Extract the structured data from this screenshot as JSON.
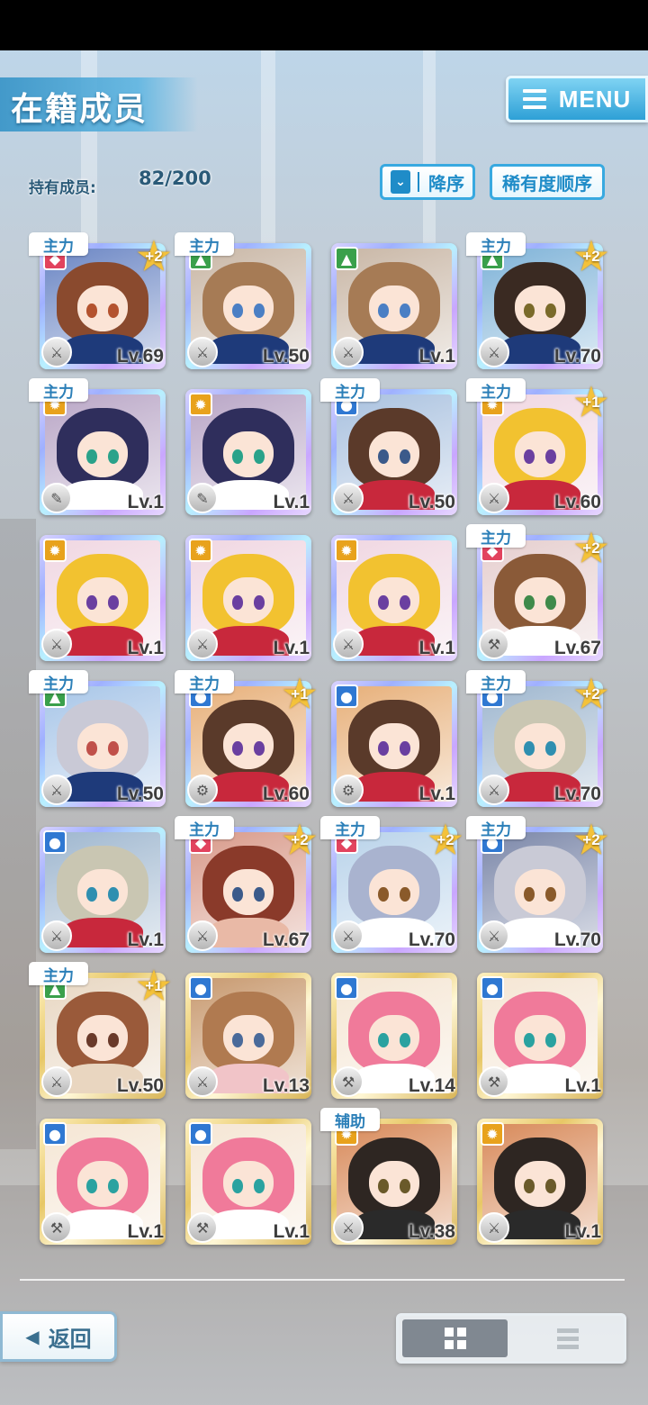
{
  "header": {
    "title": "在籍成员",
    "menu_label": "MENU"
  },
  "summary": {
    "holding_label": "持有成员:",
    "holding_count": "82/200"
  },
  "sort": {
    "order_label": "降序",
    "rarity_label": "稀有度顺序"
  },
  "colors": {
    "accent": "#2ea0d6",
    "role_tag_text": "#2b7fb8",
    "badge_gold": "#f4c23a"
  },
  "cards": [
    {
      "level": "Lv.69",
      "plus": "+2",
      "role": "主力",
      "attr": "red-icon",
      "attr_color": "#e2435e",
      "hair": "#8a4a2e",
      "eyes": "#b4532f",
      "cloth": "#1e3a7a",
      "bg": "#6b86c4",
      "frame": "rainbow",
      "type": "sword-icon"
    },
    {
      "level": "Lv.50",
      "plus": "",
      "role": "主力",
      "attr": "green-icon",
      "attr_color": "#3aa04b",
      "hair": "#a67b55",
      "eyes": "#4b7fc4",
      "cloth": "#1e3a7a",
      "bg": "#c9b7a6",
      "frame": "rainbow",
      "type": "sword-icon"
    },
    {
      "level": "Lv.1",
      "plus": "",
      "role": "",
      "attr": "green-icon",
      "attr_color": "#3aa04b",
      "hair": "#a67b55",
      "eyes": "#4b7fc4",
      "cloth": "#1e3a7a",
      "bg": "#c9b7a6",
      "frame": "rainbow",
      "type": "sword-icon"
    },
    {
      "level": "Lv.70",
      "plus": "+2",
      "role": "主力",
      "attr": "green-icon",
      "attr_color": "#3aa04b",
      "hair": "#3a2a22",
      "eyes": "#7a6a2a",
      "cloth": "#1e3a7a",
      "bg": "#7fb3d8",
      "frame": "rainbow",
      "type": "sword-icon"
    },
    {
      "level": "Lv.1",
      "plus": "",
      "role": "主力",
      "attr": "yellow-icon",
      "attr_color": "#e8a21c",
      "hair": "#2f2e5c",
      "eyes": "#2aa28a",
      "cloth": "#ffffff",
      "bg": "#b9a6c6",
      "frame": "rainbow",
      "type": "wrench-icon"
    },
    {
      "level": "Lv.1",
      "plus": "",
      "role": "",
      "attr": "yellow-icon",
      "attr_color": "#e8a21c",
      "hair": "#2f2e5c",
      "eyes": "#2aa28a",
      "cloth": "#ffffff",
      "bg": "#b9a6c6",
      "frame": "rainbow",
      "type": "wrench-icon"
    },
    {
      "level": "Lv.50",
      "plus": "",
      "role": "主力",
      "attr": "blue-icon",
      "attr_color": "#2f78d2",
      "hair": "#5b3a2a",
      "eyes": "#3b5a8a",
      "cloth": "#c8283c",
      "bg": "#a9c1df",
      "frame": "rainbow",
      "type": "sword-icon"
    },
    {
      "level": "Lv.60",
      "plus": "+1",
      "role": "主力",
      "attr": "yellow-icon",
      "attr_color": "#e8a21c",
      "hair": "#f2c230",
      "eyes": "#6a3fa0",
      "cloth": "#c8283c",
      "bg": "#f0d7e2",
      "frame": "rainbow",
      "type": "sword-icon"
    },
    {
      "level": "Lv.1",
      "plus": "",
      "role": "",
      "attr": "yellow-icon",
      "attr_color": "#e8a21c",
      "hair": "#f2c230",
      "eyes": "#6a3fa0",
      "cloth": "#c8283c",
      "bg": "#f0d7e2",
      "frame": "rainbow",
      "type": "sword-icon"
    },
    {
      "level": "Lv.1",
      "plus": "",
      "role": "",
      "attr": "yellow-icon",
      "attr_color": "#e8a21c",
      "hair": "#f2c230",
      "eyes": "#6a3fa0",
      "cloth": "#c8283c",
      "bg": "#f0d7e2",
      "frame": "rainbow",
      "type": "sword-icon"
    },
    {
      "level": "Lv.1",
      "plus": "",
      "role": "",
      "attr": "yellow-icon",
      "attr_color": "#e8a21c",
      "hair": "#f2c230",
      "eyes": "#6a3fa0",
      "cloth": "#c8283c",
      "bg": "#f0d7e2",
      "frame": "rainbow",
      "type": "sword-icon"
    },
    {
      "level": "Lv.67",
      "plus": "+2",
      "role": "主力",
      "attr": "red-icon",
      "attr_color": "#e2435e",
      "hair": "#8a5a38",
      "eyes": "#3f8a4a",
      "cloth": "#ffffff",
      "bg": "#e6cfcf",
      "frame": "rainbow",
      "type": "hammer-icon"
    },
    {
      "level": "Lv.50",
      "plus": "",
      "role": "主力",
      "attr": "green-icon",
      "attr_color": "#3aa04b",
      "hair": "#c9c9d6",
      "eyes": "#c0504a",
      "cloth": "#1e3a7a",
      "bg": "#a8c6e8",
      "frame": "rainbow",
      "type": "sword-icon"
    },
    {
      "level": "Lv.60",
      "plus": "+1",
      "role": "主力",
      "attr": "blue-icon",
      "attr_color": "#2f78d2",
      "hair": "#5a3a2a",
      "eyes": "#6a3fa0",
      "cloth": "#c8283c",
      "bg": "#e7b07a",
      "frame": "rainbow",
      "type": "gear-icon"
    },
    {
      "level": "Lv.1",
      "plus": "",
      "role": "",
      "attr": "blue-icon",
      "attr_color": "#2f78d2",
      "hair": "#5a3a2a",
      "eyes": "#6a3fa0",
      "cloth": "#c8283c",
      "bg": "#e7b07a",
      "frame": "rainbow",
      "type": "gear-icon"
    },
    {
      "level": "Lv.70",
      "plus": "+2",
      "role": "主力",
      "attr": "blue-icon",
      "attr_color": "#2f78d2",
      "hair": "#c9c6b2",
      "eyes": "#2f8fb0",
      "cloth": "#c8283c",
      "bg": "#9fb7cf",
      "frame": "rainbow",
      "type": "sword-icon"
    },
    {
      "level": "Lv.1",
      "plus": "",
      "role": "",
      "attr": "blue-icon",
      "attr_color": "#2f78d2",
      "hair": "#c9c6b2",
      "eyes": "#2f8fb0",
      "cloth": "#c8283c",
      "bg": "#9fb7cf",
      "frame": "rainbow",
      "type": "sword-icon"
    },
    {
      "level": "Lv.67",
      "plus": "+2",
      "role": "主力",
      "attr": "red-icon",
      "attr_color": "#e2435e",
      "hair": "#8a3a2a",
      "eyes": "#3b5a8a",
      "cloth": "#e9b9a6",
      "bg": "#d89a8a",
      "frame": "rainbow",
      "type": "sword-icon"
    },
    {
      "level": "Lv.70",
      "plus": "+2",
      "role": "主力",
      "attr": "red-icon",
      "attr_color": "#e2435e",
      "hair": "#a9b3cf",
      "eyes": "#8a5a2a",
      "cloth": "#ffffff",
      "bg": "#b9d3ea",
      "frame": "rainbow",
      "type": "sword-icon"
    },
    {
      "level": "Lv.70",
      "plus": "+2",
      "role": "主力",
      "attr": "blue-icon",
      "attr_color": "#2f78d2",
      "hair": "#c9cad6",
      "eyes": "#8a5a2a",
      "cloth": "#ffffff",
      "bg": "#7a86a8",
      "frame": "rainbow",
      "type": "sword-icon"
    },
    {
      "level": "Lv.50",
      "plus": "+1",
      "role": "主力",
      "attr": "green-icon",
      "attr_color": "#3aa04b",
      "hair": "#9a5a3a",
      "eyes": "#6a3a2a",
      "cloth": "#e9d6c0",
      "bg": "#e8d7c2",
      "frame": "gold",
      "type": "sword-icon"
    },
    {
      "level": "Lv.13",
      "plus": "",
      "role": "",
      "attr": "blue-icon",
      "attr_color": "#2f78d2",
      "hair": "#b07a50",
      "eyes": "#4a6a9a",
      "cloth": "#f1c4c8",
      "bg": "#c89a70",
      "frame": "gold",
      "type": "sword-icon"
    },
    {
      "level": "Lv.14",
      "plus": "",
      "role": "",
      "attr": "blue-icon",
      "attr_color": "#2f78d2",
      "hair": "#f07a9a",
      "eyes": "#2aa2a0",
      "cloth": "#ffffff",
      "bg": "#f5e6d4",
      "frame": "gold",
      "type": "hammer-icon"
    },
    {
      "level": "Lv.1",
      "plus": "",
      "role": "",
      "attr": "blue-icon",
      "attr_color": "#2f78d2",
      "hair": "#f07a9a",
      "eyes": "#2aa2a0",
      "cloth": "#ffffff",
      "bg": "#f5e6d4",
      "frame": "gold",
      "type": "hammer-icon"
    },
    {
      "level": "Lv.1",
      "plus": "",
      "role": "",
      "attr": "blue-icon",
      "attr_color": "#2f78d2",
      "hair": "#f07a9a",
      "eyes": "#2aa2a0",
      "cloth": "#ffffff",
      "bg": "#f5e6d4",
      "frame": "gold",
      "type": "hammer-icon"
    },
    {
      "level": "Lv.1",
      "plus": "",
      "role": "",
      "attr": "blue-icon",
      "attr_color": "#2f78d2",
      "hair": "#f07a9a",
      "eyes": "#2aa2a0",
      "cloth": "#ffffff",
      "bg": "#f5e6d4",
      "frame": "gold",
      "type": "hammer-icon"
    },
    {
      "level": "Lv.38",
      "plus": "",
      "role": "辅助",
      "attr": "yellow-icon",
      "attr_color": "#e8a21c",
      "hair": "#2e2622",
      "eyes": "#6a5a2a",
      "cloth": "#2a2a2a",
      "bg": "#d88a5a",
      "frame": "gold",
      "type": "sword-icon"
    },
    {
      "level": "Lv.1",
      "plus": "",
      "role": "",
      "attr": "yellow-icon",
      "attr_color": "#e8a21c",
      "hair": "#2e2622",
      "eyes": "#6a5a2a",
      "cloth": "#2a2a2a",
      "bg": "#d88a5a",
      "frame": "gold",
      "type": "sword-icon"
    }
  ],
  "footer": {
    "back_label": "返回"
  }
}
